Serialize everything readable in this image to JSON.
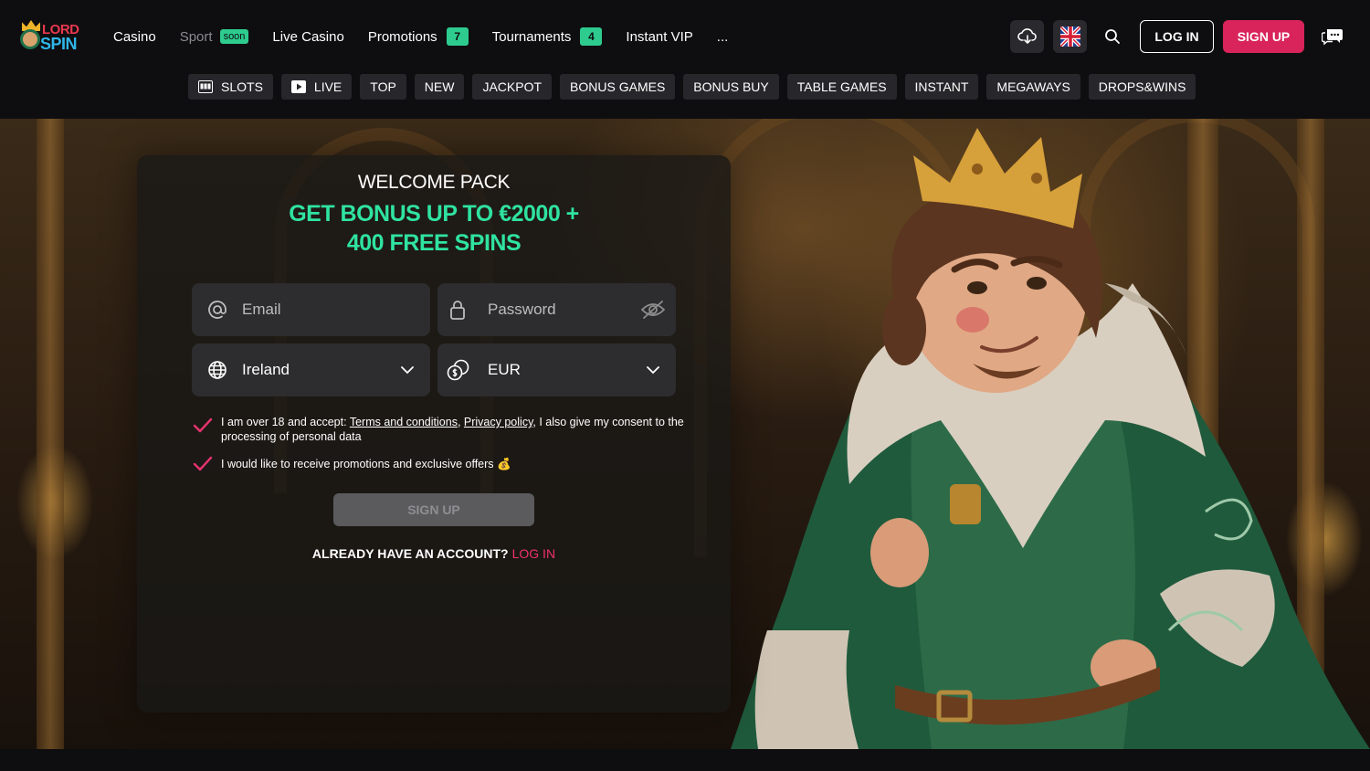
{
  "header": {
    "logo": {
      "line1": "LORD",
      "line2": "SPIN"
    },
    "nav": [
      {
        "label": "Casino",
        "badge": "",
        "count": ""
      },
      {
        "label": "Sport",
        "badge": "soon",
        "count": ""
      },
      {
        "label": "Live Casino",
        "badge": "",
        "count": ""
      },
      {
        "label": "Promotions",
        "badge": "",
        "count": "7"
      },
      {
        "label": "Tournaments",
        "badge": "",
        "count": "4"
      },
      {
        "label": "Instant VIP",
        "badge": "",
        "count": ""
      },
      {
        "label": "...",
        "badge": "",
        "count": ""
      }
    ],
    "download_icon": "cloud-download-icon",
    "language_icon": "uk-flag-icon",
    "search_icon": "search-icon",
    "login_label": "LOG IN",
    "signup_label": "SIGN UP",
    "chat_icon": "chat-icon"
  },
  "categories": [
    {
      "label": "SLOTS",
      "icon": "slots-icon"
    },
    {
      "label": "LIVE",
      "icon": "play-icon"
    },
    {
      "label": "TOP",
      "icon": ""
    },
    {
      "label": "NEW",
      "icon": ""
    },
    {
      "label": "JACKPOT",
      "icon": ""
    },
    {
      "label": "BONUS GAMES",
      "icon": ""
    },
    {
      "label": "BONUS BUY",
      "icon": ""
    },
    {
      "label": "TABLE GAMES",
      "icon": ""
    },
    {
      "label": "INSTANT",
      "icon": ""
    },
    {
      "label": "MEGAWAYS",
      "icon": ""
    },
    {
      "label": "DROPS&WINS",
      "icon": ""
    }
  ],
  "form": {
    "welcome": "WELCOME PACK",
    "bonus_line1": "GET BONUS UP TO €2000 +",
    "bonus_line2": "400 FREE SPINS",
    "email_placeholder": "Email",
    "password_placeholder": "Password",
    "country": "Ireland",
    "currency": "EUR",
    "consent_prefix": "I am over 18 and accept: ",
    "terms_link": "Terms and conditions",
    "comma": ", ",
    "privacy_link": "Privacy policy",
    "consent_suffix": ", I also give my consent to the processing of personal data",
    "promo_text": "I would like to receive promotions and exclusive offers 💰",
    "submit_label": "SIGN UP",
    "already_text": "ALREADY HAVE AN ACCOUNT?",
    "login_link": "LOG IN"
  },
  "colors": {
    "accent_green": "#2fe3a1",
    "signup_red": "#d8245a",
    "login_link_pink": "#f0306b",
    "check_pink": "#e8336f",
    "badge_green": "#2ecb8f"
  }
}
